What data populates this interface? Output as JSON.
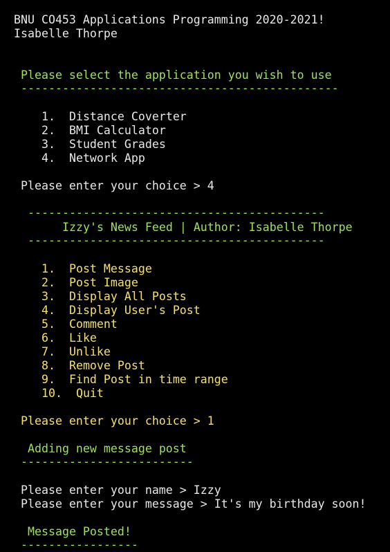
{
  "colors": {
    "background": "#000000",
    "text": "#e8e8e8",
    "green": "#9be45a",
    "yellow": "#f5e06b"
  },
  "terminal": {
    "header_line": "BNU CO453 Applications Programming 2020-2021!",
    "author_line": "Isabelle Thorpe",
    "main_prompt": "Please select the application you wish to use",
    "main_divider": "----------------------------------------------",
    "main_menu": [
      "1.  Distance Coverter",
      "2.  BMI Calculator",
      "3.  Student Grades",
      "4.  Network App"
    ],
    "choice_line_1": "Please enter your choice > 4",
    "feed_divider_top": "-------------------------------------------",
    "feed_title": "Izzy's News Feed | Author: Isabelle Thorpe",
    "feed_divider_bottom": "-------------------------------------------",
    "network_menu": [
      "1.  Post Message",
      "2.  Post Image",
      "3.  Display All Posts",
      "4.  Display User's Post",
      "5.  Comment",
      "6.  Like",
      "7.  Unlike",
      "8.  Remove Post",
      "9.  Find Post in time range",
      "10.  Quit"
    ],
    "choice_line_2": "Please enter your choice > 1",
    "adding_heading": "Adding new message post",
    "adding_divider": "-------------------------",
    "name_line": "Please enter your name > Izzy",
    "message_line": "Please enter your message > It's my birthday soon!",
    "posted_heading": "Message Posted!",
    "posted_divider": "-----------------"
  }
}
